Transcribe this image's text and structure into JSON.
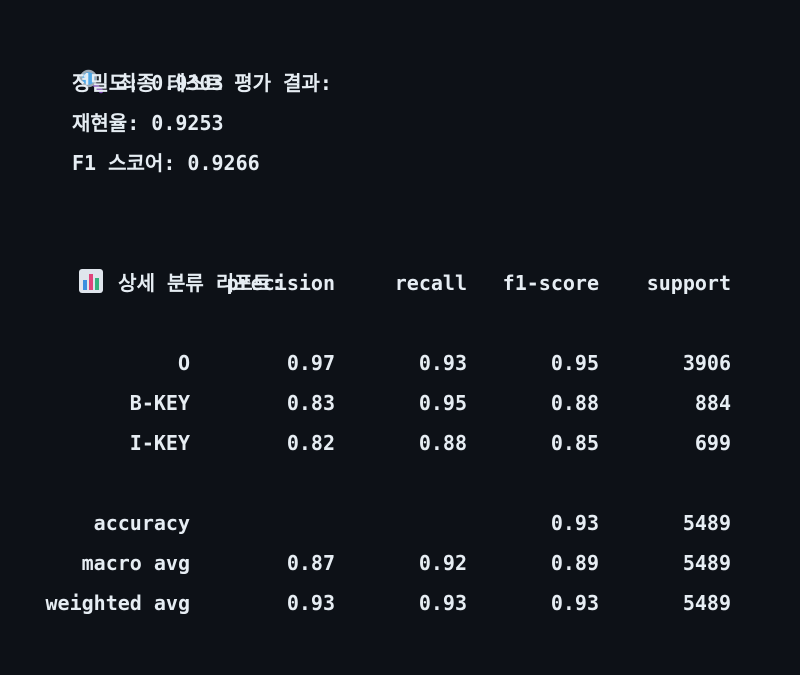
{
  "final": {
    "title": "최종 테스트 평가 결과:",
    "icon": "magnifier-icon",
    "precision": "정밀도: 0.9303",
    "recall": "재현율: 0.9253",
    "f1": "F1 스코어: 0.9266"
  },
  "report": {
    "title": "상세 분류 리포트:",
    "icon": "bar-chart-icon",
    "headers": [
      "precision",
      "recall",
      "f1-score",
      "support"
    ],
    "rows": [
      {
        "label": "O",
        "precision": "0.97",
        "recall": "0.93",
        "f1": "0.95",
        "support": "3906"
      },
      {
        "label": "B-KEY",
        "precision": "0.83",
        "recall": "0.95",
        "f1": "0.88",
        "support": "884"
      },
      {
        "label": "I-KEY",
        "precision": "0.82",
        "recall": "0.88",
        "f1": "0.85",
        "support": "699"
      }
    ],
    "summary": [
      {
        "label": "accuracy",
        "precision": "",
        "recall": "",
        "f1": "0.93",
        "support": "5489"
      },
      {
        "label": "macro avg",
        "precision": "0.87",
        "recall": "0.92",
        "f1": "0.89",
        "support": "5489"
      },
      {
        "label": "weighted avg",
        "precision": "0.93",
        "recall": "0.93",
        "f1": "0.93",
        "support": "5489"
      }
    ]
  }
}
